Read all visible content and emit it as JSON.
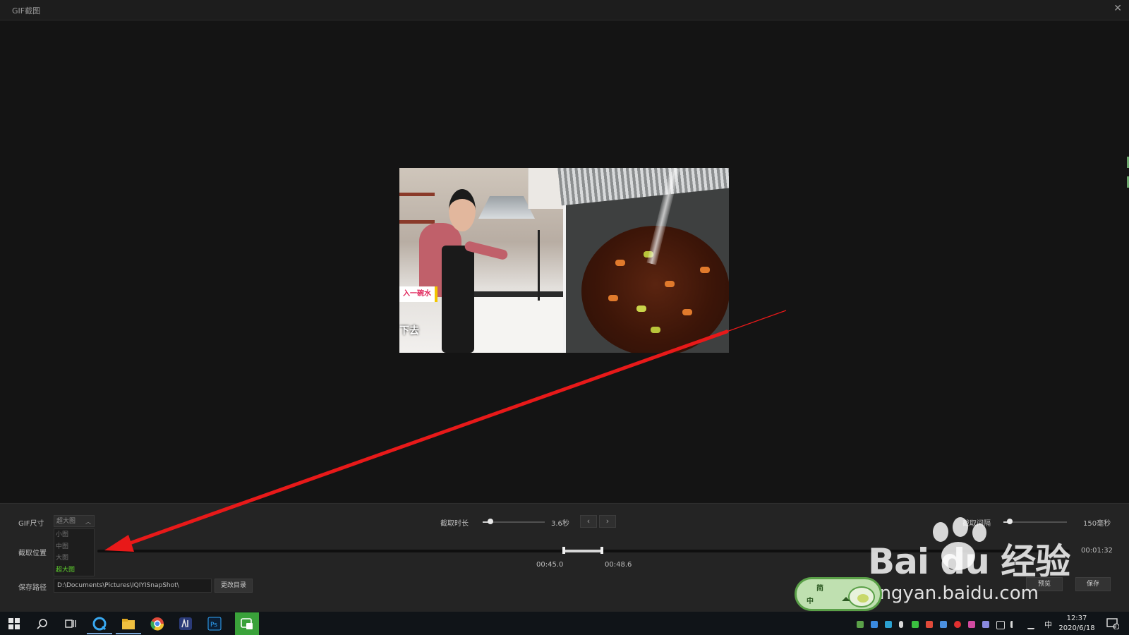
{
  "window": {
    "title": "GIF截图",
    "close_glyph": "✕"
  },
  "preview": {
    "caption_tag": "入一碗水",
    "caption_text": "下去"
  },
  "controls": {
    "gif_size": {
      "label": "GIF尺寸",
      "selected": "超大图",
      "options": [
        "小图",
        "中图",
        "大图",
        "超大图"
      ],
      "selected_index": 3
    },
    "duration": {
      "label": "截取时长",
      "value": "3.6秒",
      "level": 0.12
    },
    "interval": {
      "label": "截取间隔",
      "value": "150毫秒",
      "level": 0.1
    },
    "position": {
      "label": "截取位置",
      "start": "00:45.0",
      "end": "00:48.6",
      "total": "00:01:32"
    },
    "save_path": {
      "label": "保存路径",
      "value": "D:\\Documents\\Pictures\\IQIYISnapShot\\",
      "change_dir_button": "更改目录"
    },
    "preview_button": "预览",
    "save_button": "保存",
    "nav_prev": "‹",
    "nav_next": "›"
  },
  "watermark": {
    "logo": "Bai du 经验",
    "url": "jingyan.baidu.com"
  },
  "ime_widget": {
    "top": "简",
    "bottom": "中"
  },
  "taskbar": {
    "clock_time": "12:37",
    "clock_date": "2020/6/18",
    "ime_indicator": "中",
    "notification_count": "8"
  },
  "colors": {
    "accent_green": "#5fcf2e",
    "arrow_red": "#e81919",
    "taskbar_bg": "#101418"
  }
}
